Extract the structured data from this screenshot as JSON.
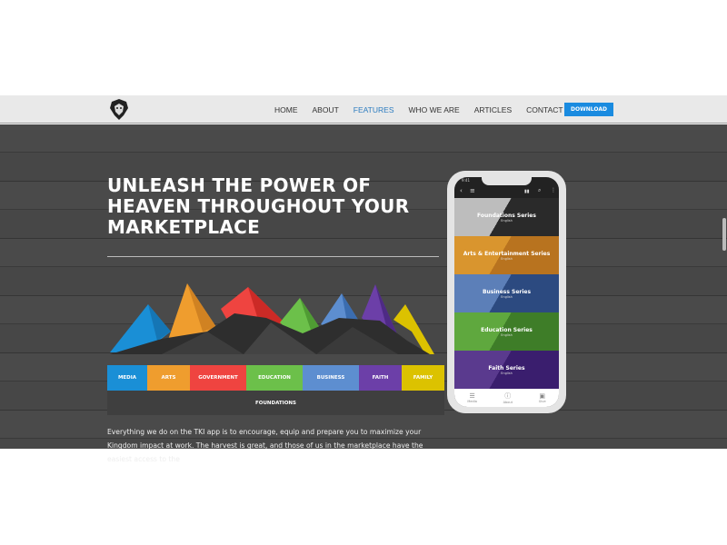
{
  "nav": {
    "items": [
      "HOME",
      "ABOUT",
      "FEATURES",
      "WHO WE ARE",
      "ARTICLES",
      "CONTACT"
    ],
    "active": "FEATURES",
    "download": "DOWNLOAD"
  },
  "hero": {
    "title": "UNLEASH THE POWER OF HEAVEN THROUGHOUT YOUR MARKETPLACE",
    "categories": [
      {
        "label": "MEDIA",
        "color": "#1a8fd6"
      },
      {
        "label": "ARTS",
        "color": "#ef9d2e"
      },
      {
        "label": "GOVERNMENT",
        "color": "#ef4440"
      },
      {
        "label": "EDUCATION",
        "color": "#6cc04a"
      },
      {
        "label": "BUSINESS",
        "color": "#5d8ed0"
      },
      {
        "label": "FAITH",
        "color": "#6c3fa8"
      },
      {
        "label": "FAMILY",
        "color": "#dcc200"
      }
    ],
    "foundations": "FOUNDATIONS",
    "body": "Everything we do on the TKI app is to encourage, equip and prepare you to maximize your Kingdom impact at work. The harvest is great, and those of us in the marketplace have the easiest access to the"
  },
  "phone": {
    "time": "9:41",
    "series": [
      {
        "title": "Foundations Series",
        "sub": "English",
        "color": "#2a2a2a",
        "light": "#bdbdbd"
      },
      {
        "title": "Arts & Entertainment Series",
        "sub": "English",
        "color": "#b8731f",
        "light": "#d9952e"
      },
      {
        "title": "Business Series",
        "sub": "English",
        "color": "#2c4a80",
        "light": "#5c7fb8"
      },
      {
        "title": "Education Series",
        "sub": "English",
        "color": "#3e7d28",
        "light": "#5fa83e"
      },
      {
        "title": "Faith Series",
        "sub": "English",
        "color": "#3a1e6e",
        "light": "#5a3a8e"
      }
    ],
    "tabs": [
      "Media",
      "About",
      "Give"
    ]
  }
}
